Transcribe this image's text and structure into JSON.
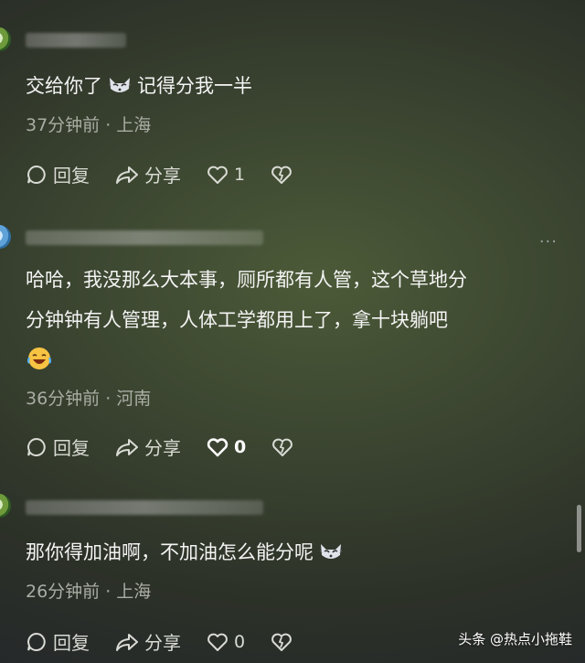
{
  "comments": [
    {
      "text": "交给你了",
      "text_after_emoji": "记得分我一半",
      "meta": "37分钟前 · 上海",
      "reply_label": "回复",
      "share_label": "分享",
      "like_count": "1"
    },
    {
      "text_line1": "哈哈，我没那么大本事，厕所都有人管，这个草地分",
      "text_line2": "分钟钟有人管理，人体工学都用上了，拿十块躺吧",
      "meta": "36分钟前 · 河南",
      "reply_label": "回复",
      "share_label": "分享",
      "like_count": "0",
      "more": "···"
    },
    {
      "text": "那你得加油啊，不加油怎么能分呢",
      "meta": "26分钟前 · 上海",
      "reply_label": "回复",
      "share_label": "分享",
      "like_count": "0"
    }
  ],
  "watermark": "头条 @热点小拖鞋",
  "colors": {
    "meta": "#a9ada4",
    "text": "#f4f4f4"
  }
}
